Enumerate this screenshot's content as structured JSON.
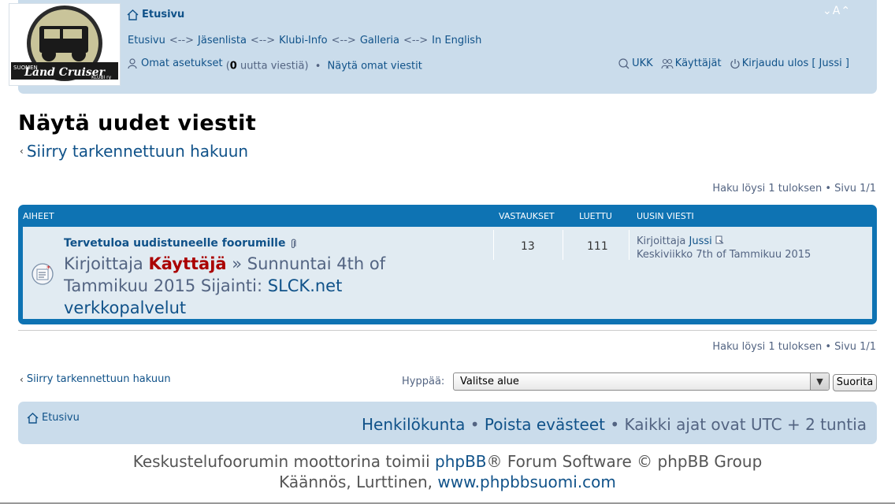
{
  "logo": {
    "line1": "SUOMEN",
    "line2": "Land Cruiser",
    "line3": "KLUBI ry"
  },
  "header": {
    "home": "Etusivu",
    "font_size_control": "A",
    "nav": [
      "Etusivu",
      "Jäsenlista",
      "Klubi-Info",
      "Galleria",
      "In English"
    ],
    "nav_separator": "<-->",
    "user_settings": "Omat asetukset",
    "new_messages_prefix": " (",
    "new_messages_count": "0",
    "new_messages_suffix": " uutta viestiä)",
    "bullet": "•",
    "own_posts": "Näytä omat viestit",
    "faq": "UKK",
    "users": "Käyttäjät",
    "logout": "Kirjaudu ulos [ Jussi ]"
  },
  "page": {
    "title": "Näytä uudet viestit",
    "advanced_search": "Siirry tarkennettuun hakuun",
    "results": "Haku löysi 1 tuloksen • Sivu 1/1"
  },
  "table": {
    "headers": {
      "topics": "AIHEET",
      "replies": "VASTAUKSET",
      "views": "LUETTU",
      "last_post": "UUSIN VIESTI"
    },
    "rows": [
      {
        "title": "Tervetuloa uudistuneelle foorumille",
        "by_label": "Kirjoittaja ",
        "author": "Käyttäjä",
        "date": " » Sunnuntai 4th of Tammikuu 2015 Sijainti: ",
        "forum": "SLCK.net verkkopalvelut",
        "replies": "13",
        "views": "111",
        "last_by_label": "Kirjoittaja ",
        "last_author": "Jussi",
        "last_date": "Keskiviikko 7th of Tammikuu 2015"
      }
    ]
  },
  "jump": {
    "label": "Hyppää:",
    "selected": "Valitse alue",
    "go": "Suorita"
  },
  "footer": {
    "home": "Etusivu",
    "staff": "Henkilökunta",
    "delete_cookies": "Poista evästeet",
    "timezone": "Kaikki ajat ovat UTC + 2 tuntia",
    "bullet": "•",
    "powered_prefix": "Keskustelufoorumin moottorina toimii ",
    "phpbb": "phpBB",
    "powered_suffix": "® Forum Software © phpBB Group",
    "translation_prefix": "Käännös, Lurttinen, ",
    "translation_link": "www.phpbbsuomi.com"
  },
  "colors": {
    "header_bg": "#cadceb",
    "table_bg": "#0e73b3",
    "row_bg": "#e1ebf2",
    "link": "#105289",
    "author": "#aa0000"
  }
}
